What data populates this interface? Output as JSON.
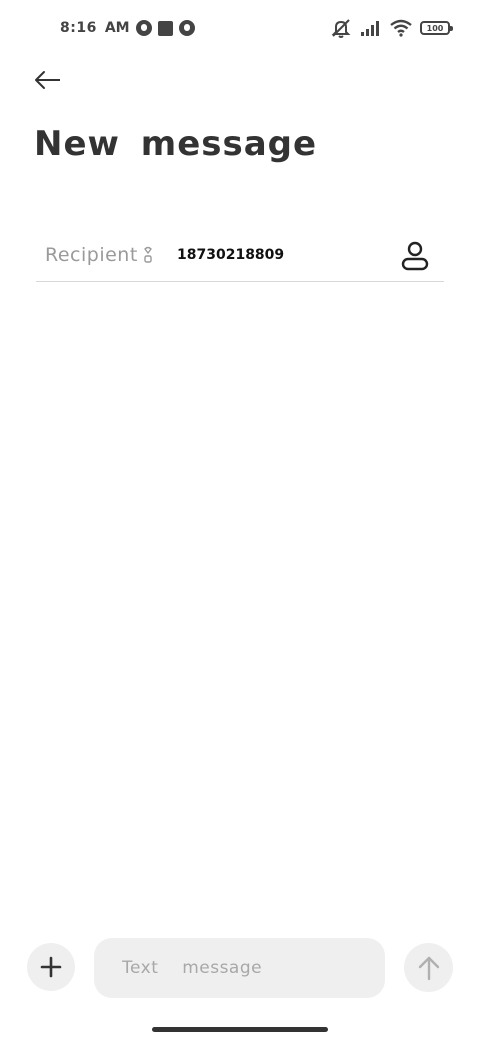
{
  "status_bar": {
    "time": "8:16",
    "ampm": "AM",
    "battery": "100"
  },
  "header": {
    "title": "New  message"
  },
  "recipient": {
    "label": "Recipient",
    "value": "18730218809"
  },
  "compose": {
    "placeholder": "Text  message"
  },
  "colors": {
    "background": "#ffffff",
    "text": "#333333",
    "muted": "#9a9a9a",
    "control_bg": "#efefef"
  }
}
